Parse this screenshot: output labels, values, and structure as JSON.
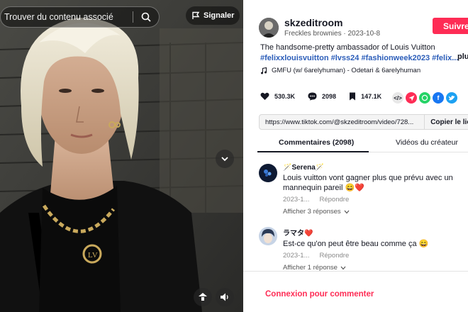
{
  "search": {
    "placeholder": "Trouver du contenu associé"
  },
  "video": {
    "report_label": "Signaler",
    "controls": {
      "scroll_icon": "chevron-down-icon",
      "pip_icon": "floating-player-icon",
      "volume_icon": "volume-icon"
    }
  },
  "author": {
    "username": "skzeditroom",
    "nickname": "Freckles brownies",
    "date": "2023-10-8",
    "follow_label": "Suivre"
  },
  "post": {
    "caption": "The handsome-pretty ambassador of Louis Vuitton",
    "hashtags": "#felixxlouisvuitton #lvss24 #fashionweek2023 #felix...",
    "more_label": "plus",
    "music": "GMFU (w/ 6arelyhuman) - Odetari & 6arelyhuman"
  },
  "stats": {
    "likes": "530.3K",
    "comments": "2098",
    "saves": "147.1K"
  },
  "share": {
    "link_url": "https://www.tiktok.com/@skzeditroom/video/728...",
    "copy_label": "Copier le lien",
    "icons": [
      "embed-icon",
      "send-icon",
      "whatsapp-icon",
      "facebook-icon",
      "twitter-icon"
    ]
  },
  "tabs": [
    {
      "label": "Commentaires (2098)"
    },
    {
      "label": "Vidéos du créateur"
    }
  ],
  "comments": [
    {
      "name": "🪄Serena🪄",
      "text": "Louis vuitton vont gagner plus que prévu avec un mannequin pareil 😄❤️",
      "date": "2023-1...",
      "reply_label": "Répondre",
      "view_replies": "Afficher 3 réponses"
    },
    {
      "name": "ラマタ❤️",
      "text": "Est-ce qu'on peut être beau comme ça 😄",
      "date": "2023-1...",
      "reply_label": "Répondre",
      "view_replies": "Afficher 1 réponse"
    }
  ],
  "login": {
    "label": "Connexion pour commenter"
  },
  "colors": {
    "accent": "#fe2c55",
    "hashtag": "#2b5db9",
    "text": "#161823"
  }
}
